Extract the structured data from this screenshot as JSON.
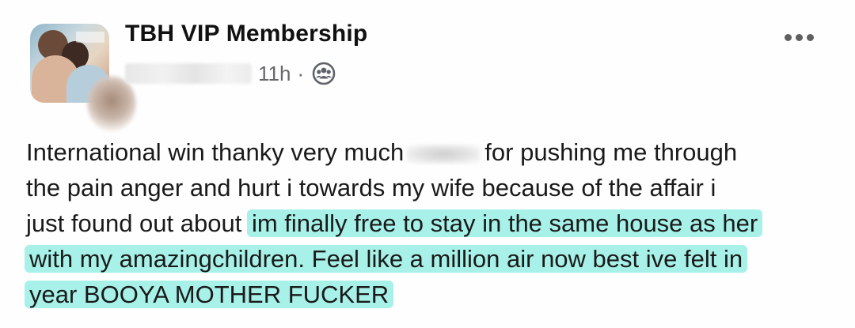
{
  "post": {
    "page_name": "TBH VIP Membership",
    "timestamp": "11h",
    "separator": "·",
    "audience_icon": "group-icon",
    "more_icon": "more-options-icon",
    "text": {
      "line1_a": "International win thanky very much",
      "line1_b": "for pushing me through",
      "line2": "the pain anger and hurt  i towards my wife because of the affair i",
      "line3_a": "just found out about ",
      "line3_hl": "im finally free to stay in the same house as her",
      "line4_hl": "with my amazingchildren.  Feel like a million air now best ive felt in",
      "line5_hl": "year BOOYA MOTHER FUCKER"
    },
    "highlight_color": "#5fe6d6"
  }
}
